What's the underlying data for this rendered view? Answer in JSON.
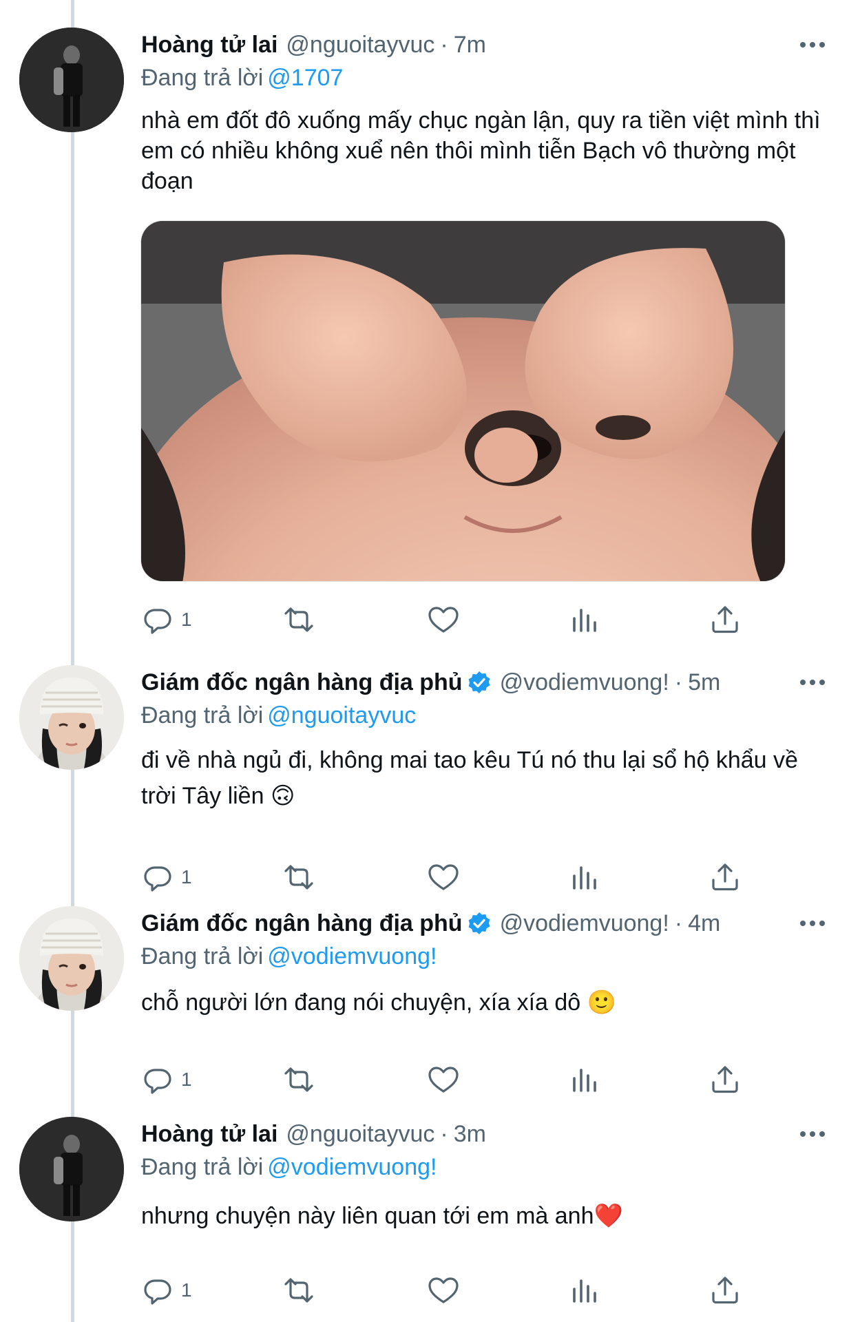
{
  "tweets": [
    {
      "author": "Hoàng tử lai",
      "handle": "@nguoitayvuc",
      "separator": "·",
      "time": "7m",
      "verified": false,
      "reply_prefix": "Đang trả lời",
      "reply_to": "@1707",
      "text": "nhà em đốt đô xuống mấy chục ngàn lận, quy ra tiền việt mình thì em có nhiều không xuể nên thôi mình tiễn Bạch vô thường một đoạn",
      "reply_count": "1",
      "avatar_icon": "avatar-dark-figure-icon"
    },
    {
      "author": "Giám đốc ngân hàng địa phủ",
      "handle": "@vodiemvuong!",
      "separator": "·",
      "time": "5m",
      "verified": true,
      "reply_prefix": "Đang trả lời",
      "reply_to": "@nguoitayvuc",
      "text": "đi về nhà ngủ đi, không mai tao kêu Tú nó thu lại sổ hộ khẩu về trời Tây liền 🙃",
      "reply_count": "1",
      "avatar_icon": "avatar-beanie-person-icon"
    },
    {
      "author": "Giám đốc ngân hàng địa phủ",
      "handle": "@vodiemvuong!",
      "separator": "·",
      "time": "4m",
      "verified": true,
      "reply_prefix": "Đang trả lời",
      "reply_to": "@vodiemvuong!",
      "text": "chỗ người lớn đang nói chuyện, xía xía dô 🙂",
      "reply_count": "1",
      "avatar_icon": "avatar-beanie-person-icon"
    },
    {
      "author": "Hoàng tử lai",
      "handle": "@nguoitayvuc",
      "separator": "·",
      "time": "3m",
      "verified": false,
      "reply_prefix": "Đang trả lời",
      "reply_to": "@vodiemvuong!",
      "text": "nhưng chuyện này liên quan tới em mà anh❤️",
      "reply_count": "1",
      "avatar_icon": "avatar-dark-figure-icon"
    }
  ],
  "colors": {
    "accent": "#1d9bf0",
    "secondary_text": "#536471",
    "thread_line": "#cfd9de"
  },
  "icons": [
    "reply-icon",
    "retweet-icon",
    "like-icon",
    "views-icon",
    "share-icon",
    "more-icon",
    "verified-badge-icon"
  ]
}
